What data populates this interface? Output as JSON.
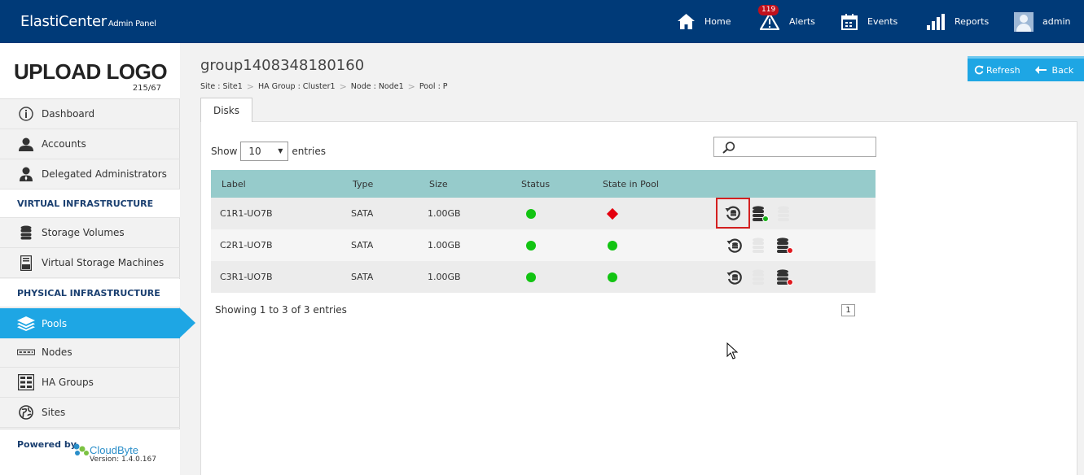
{
  "header": {
    "brand": "ElastiCenter",
    "brand_sub": "Admin Panel",
    "nav": {
      "home": "Home",
      "alerts": "Alerts",
      "alerts_count": "119",
      "events": "Events",
      "reports": "Reports",
      "user": "admin"
    }
  },
  "sidebar": {
    "logo": "UPLOAD LOGO",
    "logo_dims": "215/67",
    "items": {
      "dashboard": "Dashboard",
      "accounts": "Accounts",
      "delegated": "Delegated Administrators",
      "virtual_head": "VIRTUAL INFRASTRUCTURE",
      "storage_volumes": "Storage Volumes",
      "vsm": "Virtual Storage Machines",
      "physical_head": "PHYSICAL INFRASTRUCTURE",
      "pools": "Pools",
      "nodes": "Nodes",
      "ha_groups": "HA Groups",
      "sites": "Sites"
    },
    "powered_by": "Powered by",
    "vendor": "CloudByte",
    "version": "Version: 1.4.0.167"
  },
  "page": {
    "title": "group1408348180160",
    "breadcrumb": [
      "Site : Site1",
      "HA Group : Cluster1",
      "Node : Node1",
      "Pool : P"
    ],
    "refresh": "Refresh",
    "back": "Back",
    "tab": "Disks"
  },
  "table": {
    "show_label": "Show",
    "entries_label": "entries",
    "page_size": "10",
    "columns": [
      "Label",
      "Type",
      "Size",
      "Status",
      "State in Pool"
    ],
    "rows": [
      {
        "label": "C1R1-UO7B",
        "type": "SATA",
        "size": "1.00GB",
        "status": "green",
        "state": "red-diamond"
      },
      {
        "label": "C2R1-UO7B",
        "type": "SATA",
        "size": "1.00GB",
        "status": "green",
        "state": "green"
      },
      {
        "label": "C3R1-UO7B",
        "type": "SATA",
        "size": "1.00GB",
        "status": "green",
        "state": "green"
      }
    ],
    "info": "Showing 1 to 3 of 3 entries",
    "current_page": "1"
  },
  "colors": {
    "topbar": "#003a78",
    "accent": "#1ea6e4",
    "table_header": "#96cbcb",
    "ok": "#12c412",
    "error": "#e4000f"
  }
}
